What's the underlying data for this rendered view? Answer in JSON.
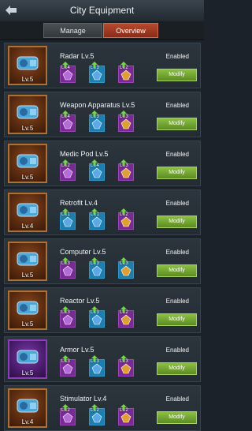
{
  "header": {
    "title": "City Equipment"
  },
  "tabs": [
    {
      "label": "Manage",
      "active": false
    },
    {
      "label": "Overview",
      "active": true
    }
  ],
  "modify_label": "Modify",
  "rows": [
    {
      "name": "Radar Lv.5",
      "level": "Lv.5",
      "status": "Enabled",
      "portrait": "radar-icon",
      "slots": [
        {
          "lv": "Lv.4",
          "color": "purple"
        },
        {
          "lv": "Lv.3",
          "color": "blue"
        },
        {
          "lv": "Lv.2",
          "color": "purple"
        }
      ]
    },
    {
      "name": "Weapon Apparatus Lv.5",
      "level": "Lv.5",
      "status": "Enabled",
      "portrait": "weapon-apparatus-icon",
      "slots": [
        {
          "lv": "Lv.4",
          "color": "purple"
        },
        {
          "lv": "Lv.3",
          "color": "blue"
        },
        {
          "lv": "Lv.3",
          "color": "purple"
        }
      ]
    },
    {
      "name": "Medic Pod Lv.5",
      "level": "Lv.5",
      "status": "Enabled",
      "portrait": "medic-pod-icon",
      "slots": [
        {
          "lv": "Lv.2",
          "color": "purple"
        },
        {
          "lv": "Lv.4",
          "color": "blue"
        },
        {
          "lv": "Lv.3",
          "color": "purple"
        }
      ]
    },
    {
      "name": "Retrofit Lv.4",
      "level": "Lv.4",
      "status": "Enabled",
      "portrait": "retrofit-icon",
      "slots": [
        {
          "lv": "Lv.1",
          "color": "blue"
        },
        {
          "lv": "Lv.1",
          "color": "blue"
        },
        {
          "lv": "Lv.2",
          "color": "purple"
        }
      ]
    },
    {
      "name": "Computer Lv.5",
      "level": "Lv.5",
      "status": "Enabled",
      "portrait": "computer-icon",
      "slots": [
        {
          "lv": "Lv.3",
          "color": "purple"
        },
        {
          "lv": "Lv.3",
          "color": "blue"
        },
        {
          "lv": "Lv.3",
          "color": "blue"
        }
      ]
    },
    {
      "name": "Reactor Lv.5",
      "level": "Lv.5",
      "status": "Enabled",
      "portrait": "reactor-icon",
      "slots": [
        {
          "lv": "Lv.3",
          "color": "purple"
        },
        {
          "lv": "Lv.3",
          "color": "blue"
        },
        {
          "lv": "Lv.2",
          "color": "purple"
        }
      ]
    },
    {
      "name": "Armor Lv.5",
      "level": "Lv.5",
      "status": "Enabled",
      "portrait": "armor-icon",
      "slots": [
        {
          "lv": "Lv.3",
          "color": "purple"
        },
        {
          "lv": "Lv.3",
          "color": "blue"
        },
        {
          "lv": "Lv.3",
          "color": "purple"
        }
      ]
    },
    {
      "name": "Stimulator Lv.4",
      "level": "Lv.4",
      "status": "Enabled",
      "portrait": "stimulator-icon",
      "slots": [
        {
          "lv": "Lv.2",
          "color": "purple"
        },
        {
          "lv": "Lv.2",
          "color": "blue"
        },
        {
          "lv": "Lv.2",
          "color": "purple"
        }
      ]
    }
  ],
  "colors": {
    "modify_green": "#6fa632",
    "overview_tab": "#a13c22",
    "slot_blue": "#1c7fb0",
    "slot_purple": "#7a2a96"
  }
}
